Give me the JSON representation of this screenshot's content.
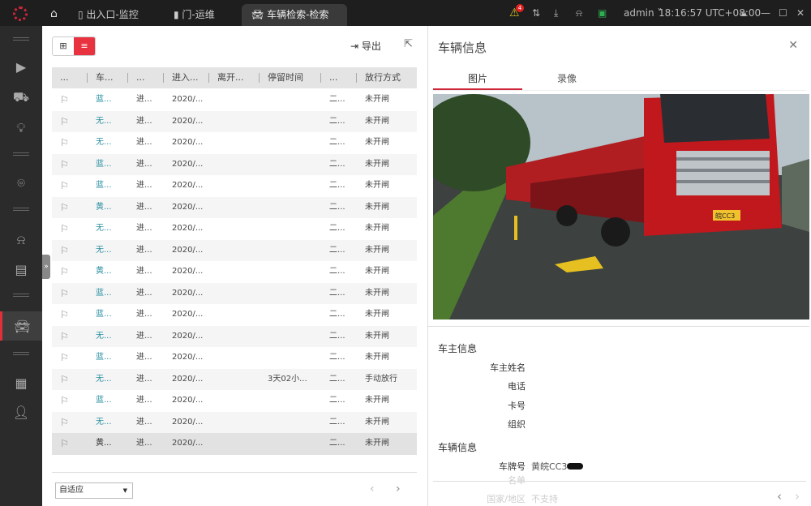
{
  "tabs": [
    {
      "label": "出入口-监控"
    },
    {
      "label": "门-运维"
    },
    {
      "label": "车辆检索-检索"
    }
  ],
  "topbar": {
    "alert_count": "4",
    "user": "admin",
    "time": "18:16:57 UTC+08:00"
  },
  "toolbar": {
    "export_label": "导出"
  },
  "table": {
    "headers": [
      "...",
      "车...",
      "...",
      "进入...",
      "离开...",
      "停留时间",
      "...",
      "放行方式"
    ],
    "rows": [
      [
        "蓝...",
        "进...",
        "2020/...",
        "",
        "",
        "二...",
        "未开闸"
      ],
      [
        "无...",
        "进...",
        "2020/...",
        "",
        "",
        "二...",
        "未开闸"
      ],
      [
        "无...",
        "进...",
        "2020/...",
        "",
        "",
        "二...",
        "未开闸"
      ],
      [
        "蓝...",
        "进...",
        "2020/...",
        "",
        "",
        "二...",
        "未开闸"
      ],
      [
        "蓝...",
        "进...",
        "2020/...",
        "",
        "",
        "二...",
        "未开闸"
      ],
      [
        "黄...",
        "进...",
        "2020/...",
        "",
        "",
        "二...",
        "未开闸"
      ],
      [
        "无...",
        "进...",
        "2020/...",
        "",
        "",
        "二...",
        "未开闸"
      ],
      [
        "无...",
        "进...",
        "2020/...",
        "",
        "",
        "二...",
        "未开闸"
      ],
      [
        "黄...",
        "进...",
        "2020/...",
        "",
        "",
        "二...",
        "未开闸"
      ],
      [
        "蓝...",
        "进...",
        "2020/...",
        "",
        "",
        "二...",
        "未开闸"
      ],
      [
        "蓝...",
        "进...",
        "2020/...",
        "",
        "",
        "二...",
        "未开闸"
      ],
      [
        "无...",
        "进...",
        "2020/...",
        "",
        "",
        "二...",
        "未开闸"
      ],
      [
        "蓝...",
        "进...",
        "2020/...",
        "",
        "",
        "二...",
        "未开闸"
      ],
      [
        "无...",
        "进...",
        "2020/...",
        "",
        "3天02小...",
        "二...",
        "手动放行"
      ],
      [
        "蓝...",
        "进...",
        "2020/...",
        "",
        "",
        "二...",
        "未开闸"
      ],
      [
        "无...",
        "进...",
        "2020/...",
        "",
        "",
        "二...",
        "未开闸"
      ],
      [
        "黄...",
        "进...",
        "2020/...",
        "",
        "",
        "二...",
        "未开闸"
      ]
    ]
  },
  "footer": {
    "layout_select": "自适应"
  },
  "panel": {
    "title": "车辆信息",
    "tabs": [
      "图片",
      "录像"
    ],
    "owner_section": "车主信息",
    "owner_fields": [
      "车主姓名",
      "电话",
      "卡号",
      "组织"
    ],
    "vehicle_section": "车辆信息",
    "plate_label": "车牌号",
    "plate_value": "黄皖CC3",
    "list_label": "名单",
    "region_label": "国家/地区",
    "region_value": "不支持",
    "photo_plate": "皖CC3"
  }
}
